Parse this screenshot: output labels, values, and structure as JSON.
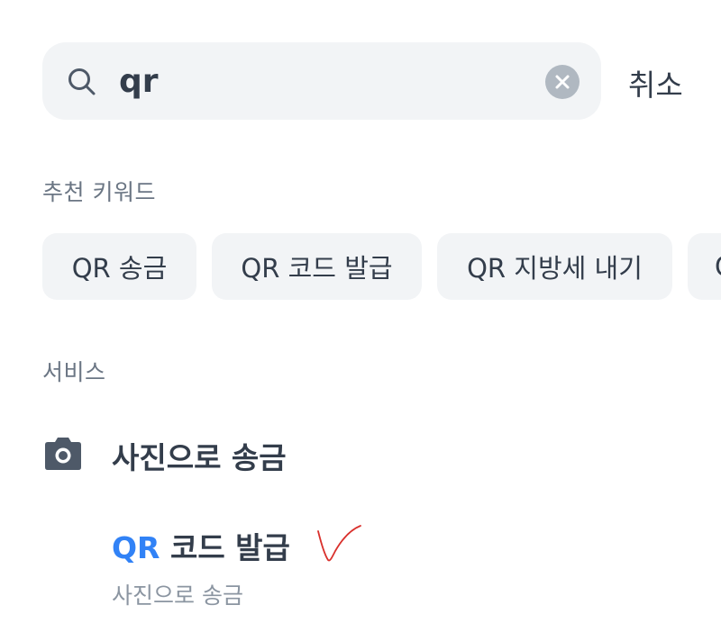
{
  "search": {
    "value": "qr",
    "cancel_label": "취소"
  },
  "keywords": {
    "title": "추천 키워드",
    "items": [
      "QR 송금",
      "QR 코드 발급",
      "QR 지방세 내기",
      "Q"
    ]
  },
  "services": {
    "title": "서비스",
    "items": [
      {
        "label": "사진으로 송금",
        "icon": "camera-icon"
      },
      {
        "label_highlight": "QR",
        "label_rest": " 코드 발급",
        "subtitle": "사진으로 송금"
      }
    ]
  },
  "colors": {
    "accent": "#3182f6",
    "chip_bg": "#f2f4f6",
    "text": "#333d4b",
    "muted": "#6b7684",
    "annotation": "#d9302c"
  }
}
